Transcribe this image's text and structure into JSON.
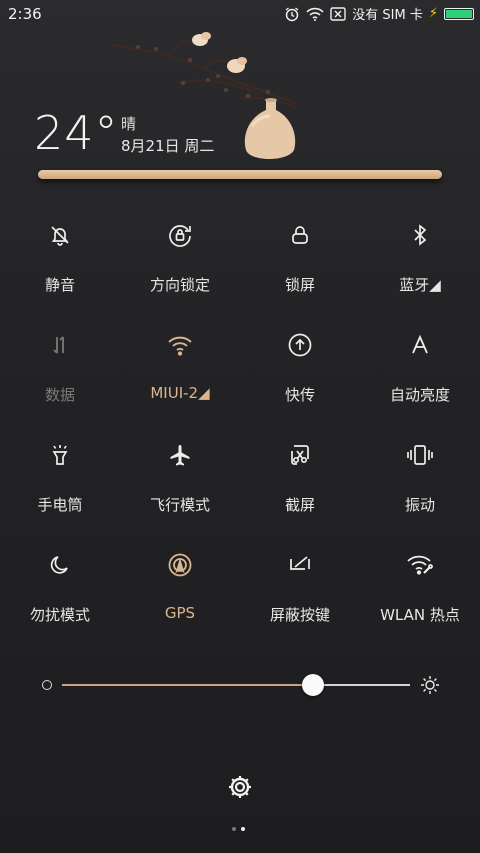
{
  "status_bar": {
    "time": "2:36",
    "sim_text": "没有 SIM 卡",
    "battery_color": "#2fd07a"
  },
  "weather": {
    "temperature": "24°",
    "condition": "晴",
    "date": "8月21日 周二"
  },
  "tiles": [
    {
      "label": "静音",
      "icon": "bell-off-icon"
    },
    {
      "label": "方向锁定",
      "icon": "rotation-lock-icon"
    },
    {
      "label": "锁屏",
      "icon": "lock-icon"
    },
    {
      "label": "蓝牙◢",
      "icon": "bluetooth-icon"
    },
    {
      "label": "数据",
      "icon": "mobile-data-icon"
    },
    {
      "label": "MIUI-2◢",
      "icon": "wifi-icon"
    },
    {
      "label": "快传",
      "icon": "quick-share-icon"
    },
    {
      "label": "自动亮度",
      "icon": "auto-brightness-icon"
    },
    {
      "label": "手电筒",
      "icon": "flashlight-icon"
    },
    {
      "label": "飞行模式",
      "icon": "airplane-icon"
    },
    {
      "label": "截屏",
      "icon": "screenshot-icon"
    },
    {
      "label": "振动",
      "icon": "vibrate-icon"
    },
    {
      "label": "勿扰模式",
      "icon": "moon-icon"
    },
    {
      "label": "GPS",
      "icon": "gps-icon"
    },
    {
      "label": "屏蔽按键",
      "icon": "block-keys-icon"
    },
    {
      "label": "WLAN 热点",
      "icon": "hotspot-icon"
    }
  ],
  "brightness": {
    "level": 0.72
  },
  "colors": {
    "accent": "#d9b690",
    "shelf": "#d8b58f"
  },
  "pager": {
    "pages": 2,
    "current": 2
  }
}
